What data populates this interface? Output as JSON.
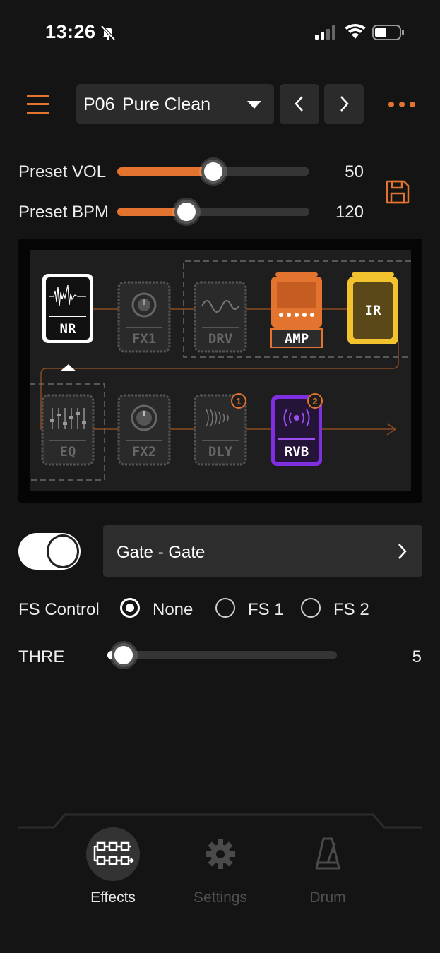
{
  "status_bar": {
    "time": "13:26"
  },
  "header": {
    "preset_number": "P06",
    "preset_name": "Pure Clean"
  },
  "colors": {
    "accent": "#e2742f",
    "amp": "#e2742f",
    "ir": "#f2c22f",
    "reverb": "#7f2ee0",
    "inactive_block": "#5a5a5a"
  },
  "sliders": {
    "volume": {
      "label": "Preset VOL",
      "value": "50",
      "fraction": 0.5
    },
    "bpm": {
      "label": "Preset BPM",
      "value": "120",
      "fraction": 0.36
    }
  },
  "chain": {
    "row1": [
      {
        "label": "NR",
        "state": "selected",
        "icon": "waveform-icon"
      },
      {
        "label": "FX1",
        "state": "off",
        "icon": "knob-icon"
      },
      {
        "label": "DRV",
        "state": "off",
        "icon": "sine-wave-icon"
      },
      {
        "label": "AMP",
        "state": "on",
        "icon": "amp-head-icon"
      },
      {
        "label": "IR",
        "state": "on",
        "icon": "cabinet-icon"
      }
    ],
    "row2": [
      {
        "label": "EQ",
        "state": "off",
        "icon": "eq-faders-icon"
      },
      {
        "label": "FX2",
        "state": "off",
        "icon": "knob-icon"
      },
      {
        "label": "DLY",
        "state": "off",
        "icon": "echo-icon",
        "badge": "1"
      },
      {
        "label": "RVB",
        "state": "on",
        "icon": "reverb-icon",
        "badge": "2"
      }
    ]
  },
  "effect_panel": {
    "enabled": true,
    "selected_effect": "Gate - Gate",
    "fs_control": {
      "label": "FS Control",
      "options": [
        "None",
        "FS 1",
        "FS 2"
      ],
      "selected": "None"
    },
    "params": [
      {
        "label": "THRE",
        "value": "5",
        "fraction": 0.07
      }
    ]
  },
  "tabs": [
    {
      "label": "Effects",
      "icon": "effects-chain-icon",
      "active": true
    },
    {
      "label": "Settings",
      "icon": "gear-icon",
      "active": false
    },
    {
      "label": "Drum",
      "icon": "metronome-icon",
      "active": false
    }
  ]
}
